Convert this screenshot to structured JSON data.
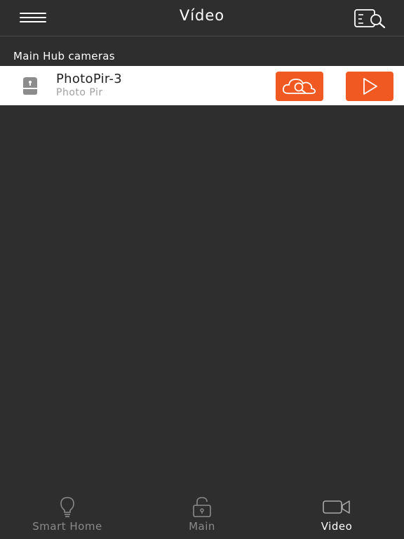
{
  "header": {
    "title": "Vídeo",
    "menu_icon": "hamburger-menu-icon",
    "search_icon": "list-search-icon"
  },
  "section": {
    "label": "Main Hub cameras"
  },
  "cameras": [
    {
      "name": "PhotoPir-3",
      "type": "Photo Pir",
      "icon": "motion-sensor-icon",
      "actions": [
        "cloud-search-icon",
        "play-icon"
      ]
    }
  ],
  "tabs": [
    {
      "label": "Smart Home",
      "icon": "lightbulb-icon",
      "active": false
    },
    {
      "label": "Main",
      "icon": "unlocked-padlock-icon",
      "active": false
    },
    {
      "label": "Video",
      "icon": "video-camera-icon",
      "active": true
    }
  ],
  "colors": {
    "background": "#2e2e2e",
    "accent": "#f05a22",
    "row_background": "#ffffff",
    "inactive_tab": "#8a8a8a"
  }
}
